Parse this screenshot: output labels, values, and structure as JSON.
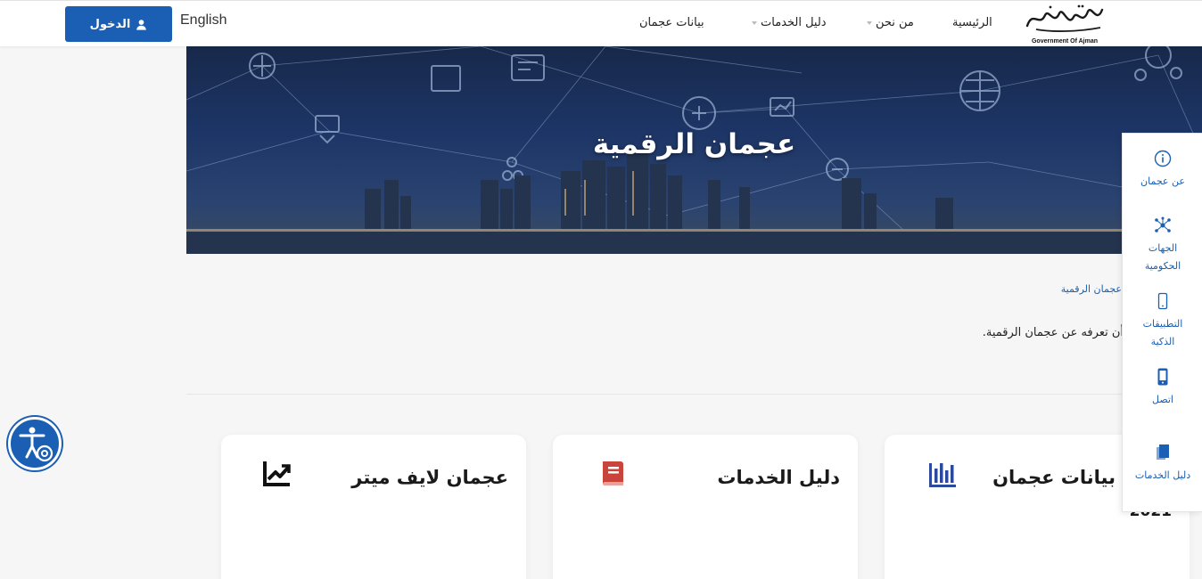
{
  "header": {
    "login_label": "الدخول",
    "language_label": "English",
    "nav": {
      "home": "الرئيسية",
      "about": "من نحن",
      "services": "دليل الخدمات",
      "data": "بيانات عجمان"
    },
    "logo_caption": "Government Of Ajman"
  },
  "hero": {
    "title": "عجمان الرقمية"
  },
  "breadcrumb": "عجمان الرقمية",
  "intro_text": "أن تعرفه عن عجمان الرقمية.",
  "cards": [
    {
      "title": "عرض بيانات عجمان",
      "subtitle": "2021",
      "icon": "bar-chart-icon"
    },
    {
      "title": "دليل الخدمات",
      "icon": "book-icon"
    },
    {
      "title": "عجمان لايف ميتر",
      "icon": "trend-line-icon"
    }
  ],
  "side_panel": [
    {
      "label": "عن عجمان",
      "icon": "info-icon"
    },
    {
      "label_line1": "الجهات",
      "label_line2": "الحكومية",
      "icon": "network-icon"
    },
    {
      "label_line1": "التطبيقات",
      "label_line2": "الذكية",
      "icon": "smartphone-outline-icon"
    },
    {
      "label": "اتصل",
      "icon": "mobile-phone-icon"
    },
    {
      "label": "دليل الخدمات",
      "icon": "documents-icon"
    }
  ],
  "colors": {
    "primary_blue": "#1a5fb4",
    "card_icon_red": "#c9443b",
    "card_icon_blue": "#2b4a9e"
  }
}
